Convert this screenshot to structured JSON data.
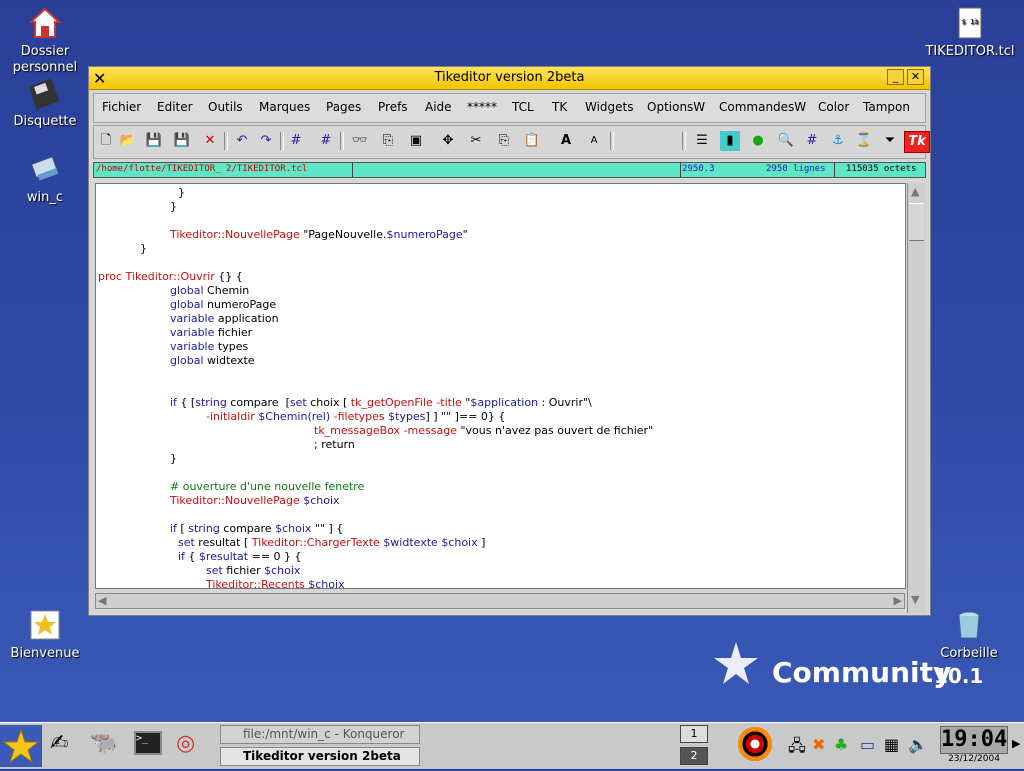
{
  "desktop": {
    "icons": [
      {
        "label": "Dossier personnel"
      },
      {
        "label": "Disquette"
      },
      {
        "label": "win_c"
      },
      {
        "label": "Bienvenue"
      },
      {
        "label": "TIKEDITOR.tcl"
      },
      {
        "label": "Corbeille"
      }
    ],
    "brand_text": "Community",
    "brand_version": "10.1"
  },
  "window": {
    "title": "Tikeditor version 2beta",
    "menu": [
      "Fichier",
      "Editer",
      "Outils",
      "Marques",
      "Pages",
      "Prefs",
      "Aide",
      "*****",
      "TCL",
      "TK",
      "Widgets",
      "OptionsW",
      "CommandesW",
      "Color",
      "Tampon"
    ],
    "tk_logo": "Tk",
    "status": {
      "path": "/home/flotte/TIKEDITOR_ 2/TIKEDITOR.tcl",
      "cursor": "2950.3",
      "lines": "2950 lignes",
      "size": "115035 octets"
    }
  },
  "code_lines": [
    "}",
    "}",
    "",
    "Tikeditor::NouvellePage \"PageNouvelle.$numeroPage\"",
    "}",
    "",
    "proc Tikeditor::Ouvrir {} {",
    "global Chemin",
    "global numeroPage",
    "variable application",
    "variable fichier",
    "variable types",
    "global widtexte",
    "",
    "",
    "if { [string compare  [set choix [ tk_getOpenFile -title \"$application : Ouvrir\"\\",
    "-initialdir $Chemin(rel) -filetypes $types] ] \"\" ]== 0} {",
    "tk_messageBox -message \"vous n'avez pas ouvert de fichier\"",
    "; return",
    "}",
    "",
    "# ouverture d'une nouvelle fenetre",
    "Tikeditor::NouvellePage $choix",
    "",
    "if [ string compare $choix \"\" ] {",
    "set resultat [ Tikeditor::ChargerTexte $widtexte $choix ]",
    "if { $resultat == 0 } {",
    "set fichier $choix",
    "Tikeditor::Recents $choix"
  ],
  "taskbar": {
    "tasks": [
      "file:/mnt/win_c - Konqueror",
      "Tikeditor version 2beta"
    ],
    "pager": [
      "1",
      "2"
    ],
    "clock": "19:04",
    "date": "23/12/2004"
  },
  "colors": {
    "titlebar": "#f2c400",
    "status_bg": "#5ee6c6",
    "keyword": "#1c1c9c",
    "function": "#c81010",
    "comment": "#0f7a0f"
  }
}
